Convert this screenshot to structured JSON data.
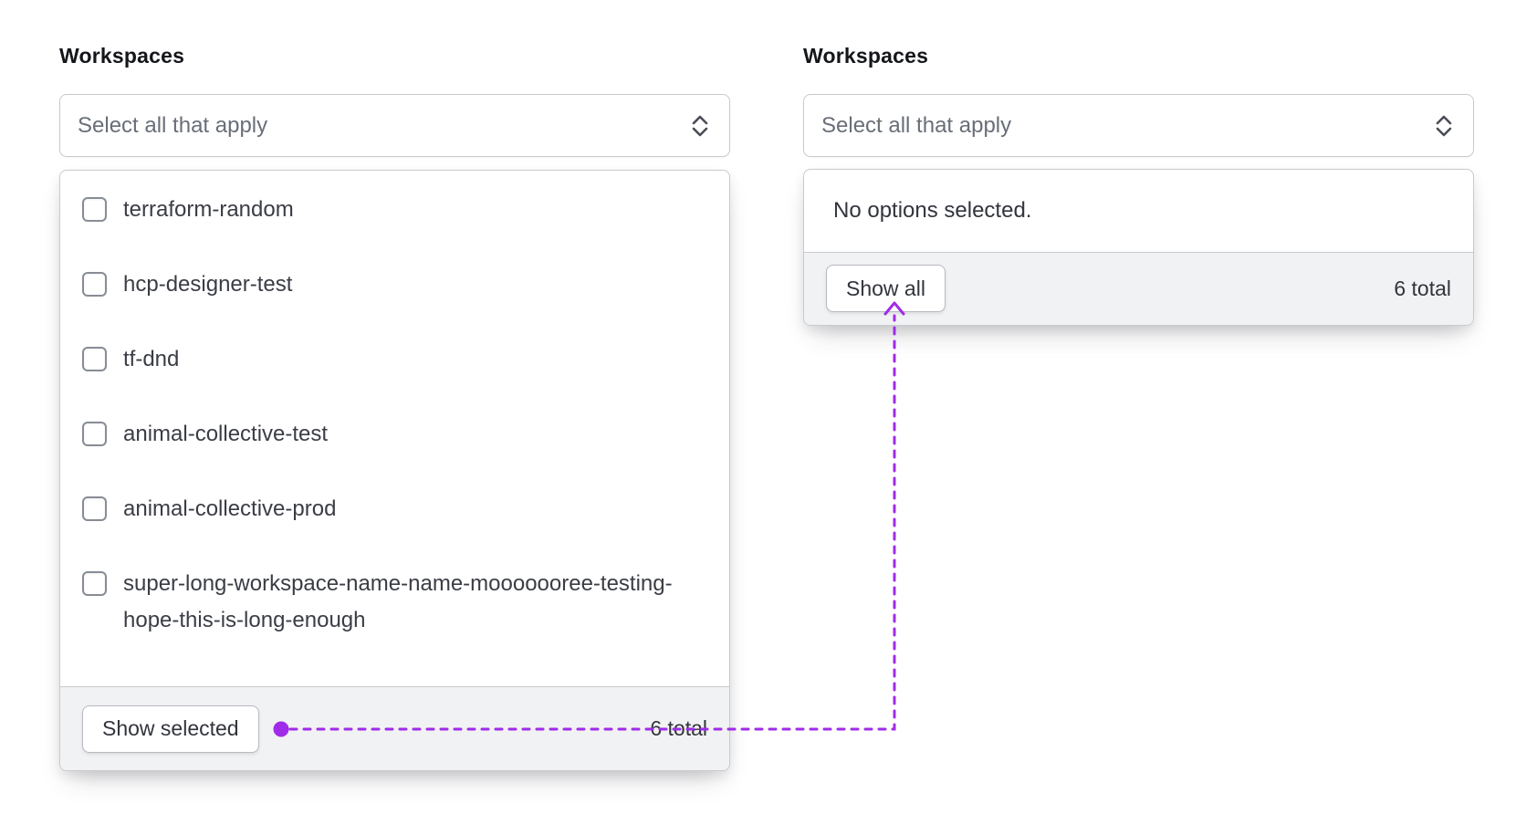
{
  "colors": {
    "annotation_purple": "#A02BE8",
    "panel_border": "#c8cace",
    "footer_background": "#f1f2f3"
  },
  "annotation": {
    "color": "#A02BE8",
    "style": "dotted-connector-from-show-selected-to-show-all"
  },
  "left": {
    "label": "Workspaces",
    "select": {
      "placeholder": "Select all that apply"
    },
    "options": [
      "terraform-random",
      "hcp-designer-test",
      "tf-dnd",
      "animal-collective-test",
      "animal-collective-prod",
      "super-long-workspace-name-name-mooooooree-testing-hope-this-is-long-enough"
    ],
    "footer": {
      "button_label": "Show selected",
      "total": "6 total"
    }
  },
  "right": {
    "label": "Workspaces",
    "select": {
      "placeholder": "Select all that apply"
    },
    "empty_message": "No options selected.",
    "footer": {
      "button_label": "Show all",
      "total": "6 total"
    }
  }
}
